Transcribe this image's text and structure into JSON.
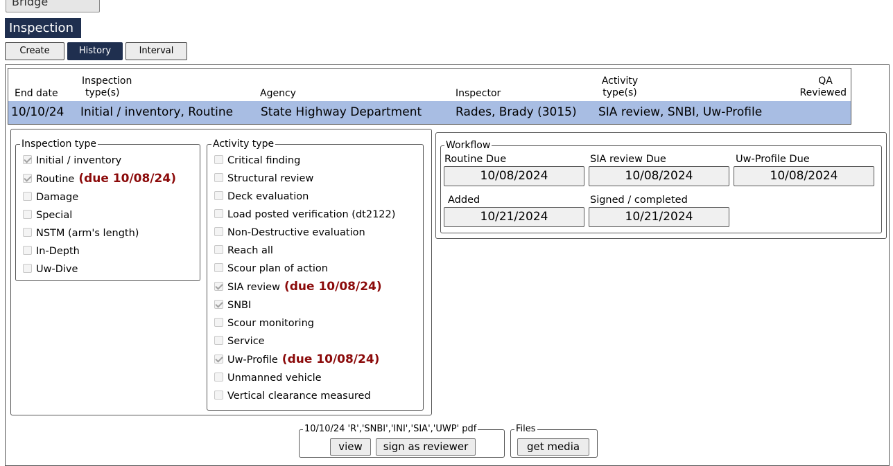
{
  "top": {
    "bridge_label": "Bridge"
  },
  "section_title": "Inspection",
  "tabs": [
    {
      "label": "Create"
    },
    {
      "label": "History"
    },
    {
      "label": "Interval"
    }
  ],
  "history": {
    "headers": {
      "end_date": "End date",
      "inspection_types_line1": "Inspection",
      "inspection_types_line2": "type(s)",
      "agency": "Agency",
      "inspector": "Inspector",
      "activity_types_line1": "Activity",
      "activity_types_line2": "type(s)",
      "qa_line1": "QA",
      "qa_line2": "Reviewed"
    },
    "row": {
      "end_date": "10/10/24",
      "inspection_types": "Initial / inventory, Routine",
      "agency": "State Highway Department",
      "inspector": "Rades, Brady (3015)",
      "activity_types": "SIA review, SNBI, Uw-Profile"
    }
  },
  "inspection_type": {
    "legend": "Inspection type",
    "items": [
      {
        "label": "Initial / inventory",
        "checked": true,
        "due": ""
      },
      {
        "label": "Routine",
        "checked": true,
        "due": "(due 10/08/24)"
      },
      {
        "label": "Damage",
        "checked": false,
        "due": ""
      },
      {
        "label": "Special",
        "checked": false,
        "due": ""
      },
      {
        "label": "NSTM (arm's length)",
        "checked": false,
        "due": ""
      },
      {
        "label": "In-Depth",
        "checked": false,
        "due": ""
      },
      {
        "label": "Uw-Dive",
        "checked": false,
        "due": ""
      }
    ]
  },
  "activity_type": {
    "legend": "Activity type",
    "items": [
      {
        "label": "Critical finding",
        "checked": false,
        "due": ""
      },
      {
        "label": "Structural review",
        "checked": false,
        "due": ""
      },
      {
        "label": "Deck evaluation",
        "checked": false,
        "due": ""
      },
      {
        "label": "Load posted verification (dt2122)",
        "checked": false,
        "due": ""
      },
      {
        "label": "Non-Destructive evaluation",
        "checked": false,
        "due": ""
      },
      {
        "label": "Reach all",
        "checked": false,
        "due": ""
      },
      {
        "label": "Scour plan of action",
        "checked": false,
        "due": ""
      },
      {
        "label": "SIA review",
        "checked": true,
        "due": "(due 10/08/24)"
      },
      {
        "label": "SNBI",
        "checked": true,
        "due": ""
      },
      {
        "label": "Scour monitoring",
        "checked": false,
        "due": ""
      },
      {
        "label": "Service",
        "checked": false,
        "due": ""
      },
      {
        "label": "Uw-Profile",
        "checked": true,
        "due": "(due 10/08/24)"
      },
      {
        "label": "Unmanned vehicle",
        "checked": false,
        "due": ""
      },
      {
        "label": "Vertical clearance measured",
        "checked": false,
        "due": ""
      }
    ]
  },
  "workflow": {
    "legend": "Workflow",
    "fields": [
      {
        "label": "Routine Due",
        "value": "10/08/2024"
      },
      {
        "label": "SIA review Due",
        "value": "10/08/2024"
      },
      {
        "label": "Uw-Profile Due",
        "value": "10/08/2024"
      },
      {
        "label": "Added",
        "value": "10/21/2024"
      },
      {
        "label": "Signed / completed",
        "value": "10/21/2024"
      }
    ]
  },
  "pdf_group": {
    "legend": "10/10/24 'R','SNBI','INI','SIA','UWP' pdf",
    "view_label": "view",
    "sign_label": "sign as reviewer"
  },
  "files_group": {
    "legend": "Files",
    "media_label": "get media"
  }
}
